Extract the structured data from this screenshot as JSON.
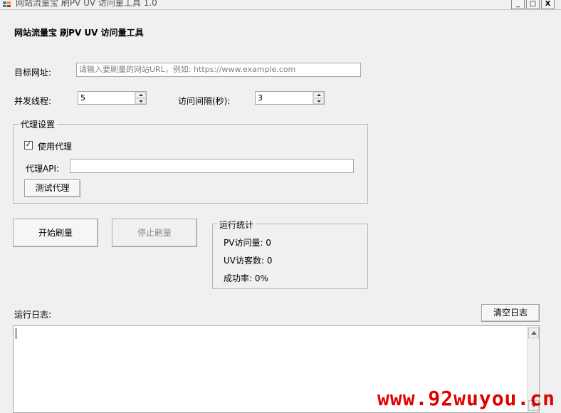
{
  "window": {
    "title": "网站流量宝 刷PV UV 访问量工具 1.0",
    "buttons": {
      "minimize": "_",
      "maximize": "□",
      "close": "X"
    }
  },
  "header": {
    "title": "网站流量宝 刷PV UV 访问量工具"
  },
  "form": {
    "url": {
      "label": "目标网址:",
      "value": "",
      "placeholder": "请输入要刷量的网站URL，例如: https://www.example.com"
    },
    "threads": {
      "label": "并发线程:",
      "value": "5"
    },
    "interval": {
      "label": "访问间隔(秒):",
      "value": "3"
    }
  },
  "proxy": {
    "group_title": "代理设置",
    "use_proxy_label": "使用代理",
    "use_proxy_checked": true,
    "api_label": "代理API:",
    "api_value": "",
    "test_button": "测试代理"
  },
  "actions": {
    "start": "开始刷量",
    "stop": "停止刷量"
  },
  "stats": {
    "group_title": "运行统计",
    "pv": "PV访问量: 0",
    "uv": "UV访客数: 0",
    "success": "成功率: 0%"
  },
  "log": {
    "label": "运行日志:",
    "clear_button": "清空日志",
    "content": ""
  },
  "watermark": {
    "text": "www.92wuyou.cn",
    "color": "#e00000"
  }
}
